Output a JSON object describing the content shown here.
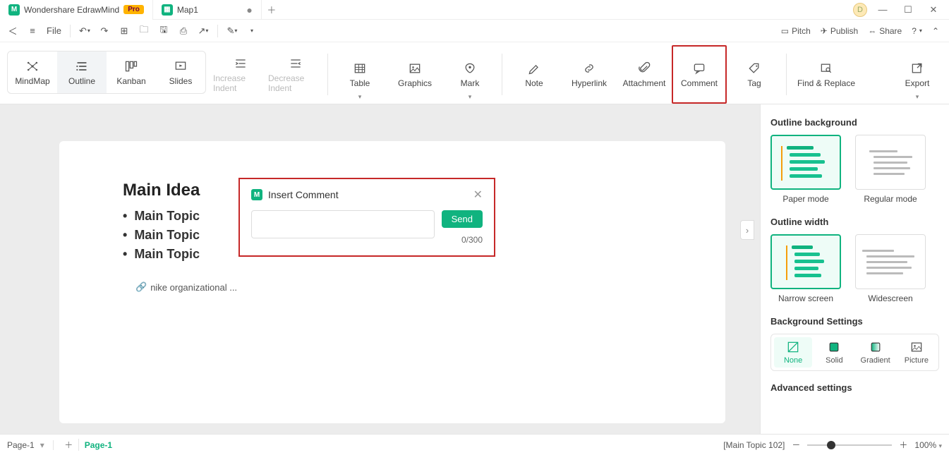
{
  "titlebar": {
    "app_name": "Wondershare EdrawMind",
    "pro": "Pro",
    "doc_tab": "Map1",
    "avatar_letter": "D"
  },
  "menubar": {
    "file": "File",
    "right": {
      "pitch": "Pitch",
      "publish": "Publish",
      "share": "Share"
    }
  },
  "ribbon": {
    "views": {
      "mindmap": "MindMap",
      "outline": "Outline",
      "kanban": "Kanban",
      "slides": "Slides"
    },
    "increase": "Increase Indent",
    "decrease": "Decrease Indent",
    "table": "Table",
    "graphics": "Graphics",
    "mark": "Mark",
    "note": "Note",
    "hyperlink": "Hyperlink",
    "attachment": "Attachment",
    "comment": "Comment",
    "tag": "Tag",
    "find": "Find & Replace",
    "export": "Export"
  },
  "canvas": {
    "main": "Main Idea",
    "topics": [
      "Main Topic",
      "Main Topic",
      "Main Topic"
    ],
    "attachment": "nike organizational ..."
  },
  "comment_popup": {
    "title": "Insert Comment",
    "send": "Send",
    "count": "0/300"
  },
  "side": {
    "bg_title": "Outline background",
    "paper": "Paper mode",
    "regular": "Regular mode",
    "width_title": "Outline width",
    "narrow": "Narrow screen",
    "wide": "Widescreen",
    "bgset_title": "Background Settings",
    "none": "None",
    "solid": "Solid",
    "gradient": "Gradient",
    "picture": "Picture",
    "adv": "Advanced settings"
  },
  "status": {
    "page_dd": "Page-1",
    "page_tab": "Page-1",
    "selection": "[Main Topic 102]",
    "zoom": "100%"
  }
}
